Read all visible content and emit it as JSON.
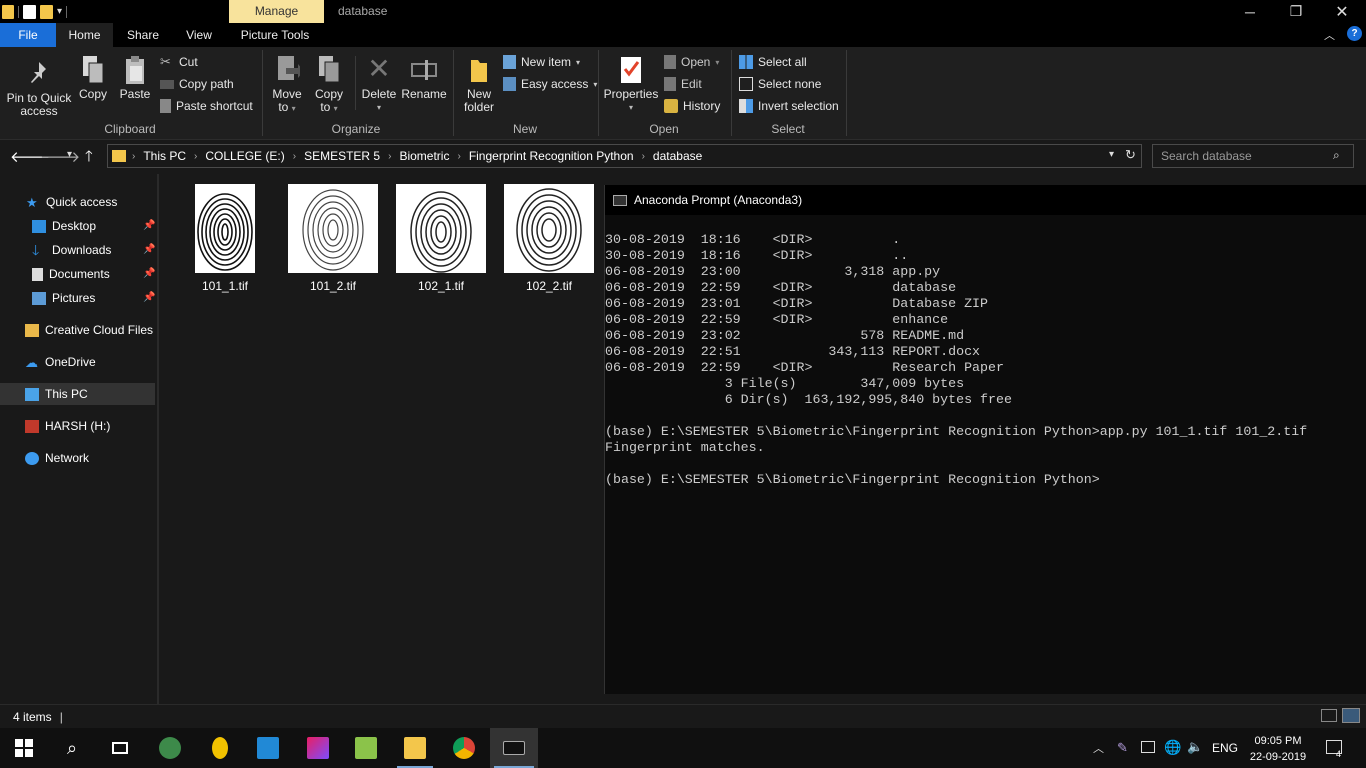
{
  "titlebar": {
    "manage_tab": "Manage",
    "window_title": "database"
  },
  "ribbon_tabs": [
    "File",
    "Home",
    "Share",
    "View",
    "Picture Tools"
  ],
  "ribbon": {
    "clipboard": {
      "pin_label_1": "Pin to Quick",
      "pin_label_2": "access",
      "copy": "Copy",
      "paste": "Paste",
      "cut": "Cut",
      "copy_path": "Copy path",
      "paste_shortcut": "Paste shortcut",
      "group": "Clipboard"
    },
    "organize": {
      "move_to_1": "Move",
      "move_to_2": "to",
      "copy_to_1": "Copy",
      "copy_to_2": "to",
      "delete": "Delete",
      "rename": "Rename",
      "group": "Organize"
    },
    "new": {
      "new_folder_1": "New",
      "new_folder_2": "folder",
      "new_item": "New item",
      "easy_access": "Easy access",
      "group": "New"
    },
    "open": {
      "properties": "Properties",
      "open": "Open",
      "edit": "Edit",
      "history": "History",
      "group": "Open"
    },
    "select": {
      "select_all": "Select all",
      "select_none": "Select none",
      "invert_selection": "Invert selection",
      "group": "Select"
    }
  },
  "address": {
    "crumbs": [
      "This PC",
      "COLLEGE (E:)",
      "SEMESTER 5",
      "Biometric",
      "Fingerprint Recognition Python",
      "database"
    ],
    "search_placeholder": "Search database"
  },
  "nav": {
    "quick_access": "Quick access",
    "desktop": "Desktop",
    "downloads": "Downloads",
    "documents": "Documents",
    "pictures": "Pictures",
    "creative_cloud": "Creative Cloud Files",
    "onedrive": "OneDrive",
    "this_pc": "This PC",
    "harsh": "HARSH (H:)",
    "network": "Network"
  },
  "files": [
    "101_1.tif",
    "101_2.tif",
    "102_1.tif",
    "102_2.tif"
  ],
  "console": {
    "title": "Anaconda Prompt (Anaconda3)",
    "lines": [
      "30-08-2019  18:16    <DIR>          .",
      "30-08-2019  18:16    <DIR>          ..",
      "06-08-2019  23:00             3,318 app.py",
      "06-08-2019  22:59    <DIR>          database",
      "06-08-2019  23:01    <DIR>          Database ZIP",
      "06-08-2019  22:59    <DIR>          enhance",
      "06-08-2019  23:02               578 README.md",
      "06-08-2019  22:51           343,113 REPORT.docx",
      "06-08-2019  22:59    <DIR>          Research Paper",
      "               3 File(s)        347,009 bytes",
      "               6 Dir(s)  163,192,995,840 bytes free",
      "",
      "(base) E:\\SEMESTER 5\\Biometric\\Fingerprint Recognition Python>app.py 101_1.tif 101_2.tif",
      "Fingerprint matches.",
      "",
      "(base) E:\\SEMESTER 5\\Biometric\\Fingerprint Recognition Python>"
    ]
  },
  "status": {
    "items": "4 items"
  },
  "tray": {
    "lang": "ENG",
    "time": "09:05 PM",
    "date": "22-09-2019",
    "notifications": "4"
  },
  "colors": {
    "file_tab": "#1a6ed8",
    "manage_tab": "#f8e39c",
    "background": "#191919"
  }
}
